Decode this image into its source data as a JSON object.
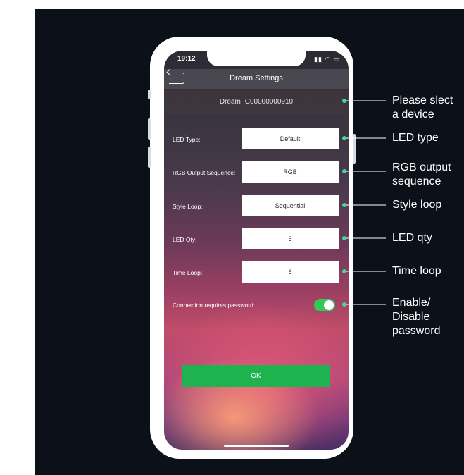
{
  "status_bar": {
    "time": "19:12"
  },
  "navbar": {
    "title": "Dream Settings"
  },
  "device": {
    "name": "Dream~C00000000910"
  },
  "fields": [
    {
      "label": "LED Type:",
      "value": "Default"
    },
    {
      "label": "RGB Output Sequence:",
      "value": "RGB"
    },
    {
      "label": "Style Loop:",
      "value": "Sequential"
    },
    {
      "label": "LED Qty:",
      "value": "6"
    },
    {
      "label": "Time Loop:",
      "value": "6"
    }
  ],
  "password": {
    "label": "Connection requires password:",
    "enabled": true
  },
  "ok_button": {
    "label": "OK"
  },
  "annotations": [
    {
      "line1": "Please slect",
      "line2": "a device"
    },
    {
      "line1": "LED type"
    },
    {
      "line1": "RGB output",
      "line2": "sequence"
    },
    {
      "line1": "Style loop"
    },
    {
      "line1": "LED qty"
    },
    {
      "line1": "Time loop"
    },
    {
      "line1": "Enable/",
      "line2": "Disable",
      "line3": "password"
    }
  ],
  "colors": {
    "accent_green": "#1fb350",
    "toggle_green": "#34c759",
    "annotation_dot": "#3ddc97"
  }
}
